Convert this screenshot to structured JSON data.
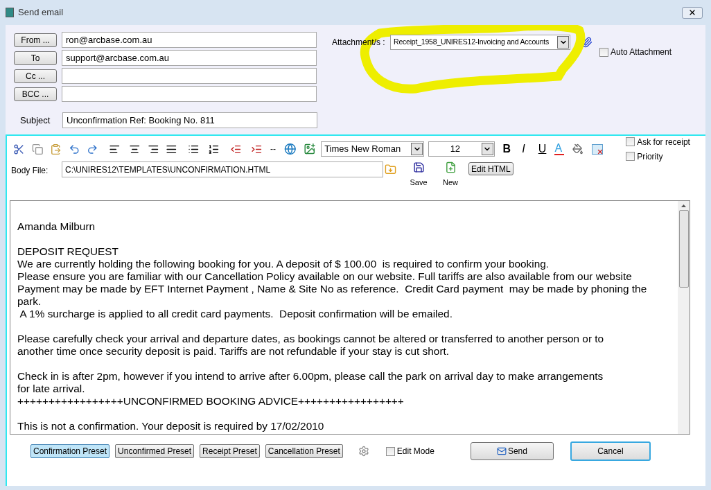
{
  "window": {
    "title": "Send email"
  },
  "recipients": [
    {
      "button": "From ...",
      "value": "ron@arcbase.com.au"
    },
    {
      "button": "To",
      "value": "support@arcbase.com.au"
    },
    {
      "button": "Cc ..."
    },
    {
      "button": "BCC ..."
    }
  ],
  "subject": {
    "label": "Subject",
    "value": "Unconfirmation Ref: Booking No. 811"
  },
  "attachment": {
    "label": "Attachment/s :",
    "value": "Receipt_1958_UNIRES12-Invoicing and Accounts"
  },
  "auto_attachment": {
    "label": "Auto Attachment",
    "checked": false
  },
  "toolbar": {
    "rule": "--",
    "font": "Times New Roman",
    "size": "12",
    "bold": "B",
    "italic": "I",
    "underline": "U",
    "text_color_button": "A"
  },
  "options": [
    {
      "label": "Ask for receipt",
      "checked": false
    },
    {
      "label": "Priority",
      "checked": false
    }
  ],
  "body_file": {
    "label": "Body File:",
    "value": "C:\\UNIRES12\\TEMPLATES\\UNCONFIRMATION.HTML"
  },
  "file_buttons": [
    {
      "label": "Save"
    },
    {
      "label": "New"
    }
  ],
  "edit_html": "Edit HTML",
  "body": [
    [
      "Amanda Milburn"
    ],
    [
      "DEPOSIT REQUEST",
      "We are currently holding the following booking for you. A deposit of $ 100.00  is required to confirm your booking.",
      "Please ensure you are familiar with our Cancellation Policy available on our website. Full tariffs are also available from our website",
      "Payment may be made by EFT Internet Payment , Name & Site No as reference.  Credit Card payment  may be made by phoning the",
      "park.",
      " A 1% surcharge is applied to all credit card payments.  Deposit confirmation will be emailed."
    ],
    [
      "Please carefully check your arrival and departure dates, as bookings cannot be altered or transferred to another person or to",
      "another time once security deposit is paid. Tariffs are not refundable if your stay is cut short."
    ],
    [
      "Check in is after 2pm, however if you intend to arrive after 6.00pm, please call the park on arrival day to make arrangements",
      "for late arrival.",
      "+++++++++++++++++UNCONFIRMED BOOKING ADVICE+++++++++++++++++"
    ],
    [
      "This is not a confirmation. Your deposit is required by 17/02/2010"
    ]
  ],
  "presets": [
    {
      "label": "Confirmation Preset",
      "selected": true
    },
    {
      "label": "Unconfirmed Preset",
      "selected": false
    },
    {
      "label": "Receipt Preset",
      "selected": false
    },
    {
      "label": "Cancellation Preset",
      "selected": false
    }
  ],
  "edit_mode": {
    "label": "Edit Mode",
    "checked": false
  },
  "send": "Send",
  "cancel": "Cancel"
}
